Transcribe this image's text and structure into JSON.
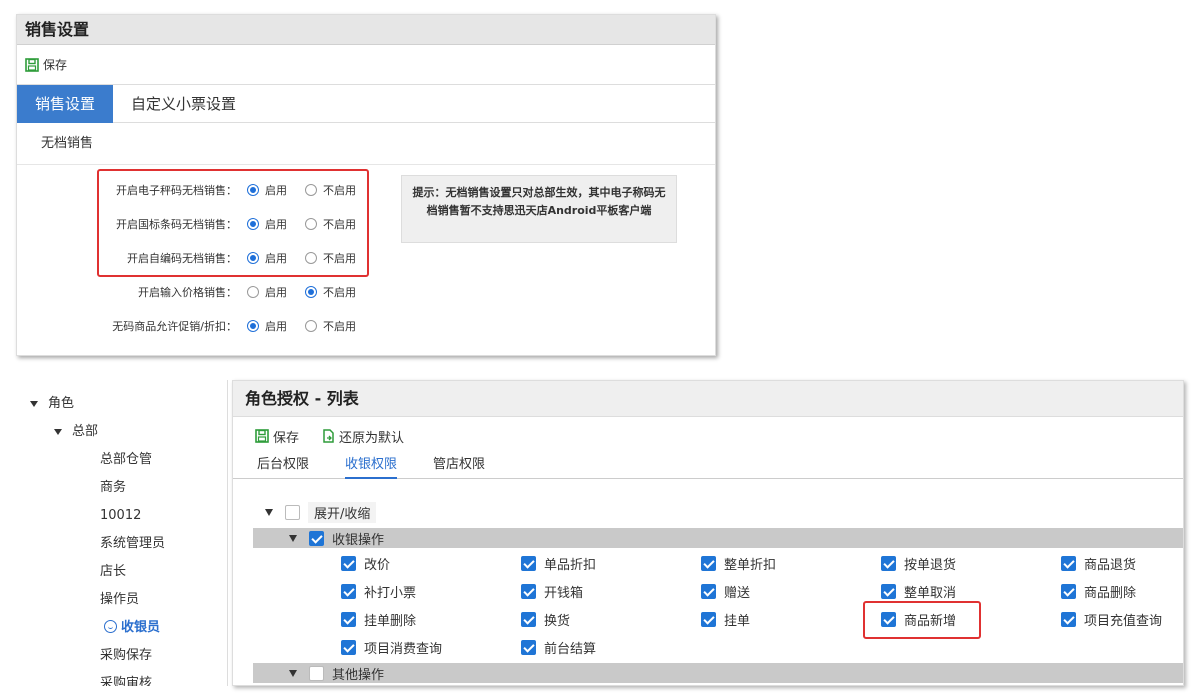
{
  "top": {
    "title": "销售设置",
    "save_label": "保存",
    "tabs": [
      {
        "label": "销售设置",
        "active": true
      },
      {
        "label": "自定义小票设置",
        "active": false
      }
    ],
    "section": "无档销售",
    "options": {
      "on": "启用",
      "off": "不启用"
    },
    "rows": [
      {
        "label": "开启电子秤码无档销售：",
        "value": "on"
      },
      {
        "label": "开启国标条码无档销售：",
        "value": "on"
      },
      {
        "label": "开启自编码无档销售：",
        "value": "on"
      },
      {
        "label": "开启输入价格销售：",
        "value": "off"
      },
      {
        "label": "无码商品允许促销/折扣：",
        "value": "on"
      }
    ],
    "tip": "提示：无档销售设置只对总部生效，其中电子称码无档销售暂不支持思迅天店Android平板客户端"
  },
  "tree": {
    "root": "角色",
    "group": "总部",
    "items": [
      "总部仓管",
      "商务",
      "10012",
      "系统管理员",
      "店长",
      "操作员",
      "收银员",
      "采购保存",
      "采购审核"
    ],
    "selected": "收银员"
  },
  "role": {
    "title": "角色授权 - 列表",
    "save_label": "保存",
    "reset_label": "还原为默认",
    "tabs": [
      {
        "label": "后台权限",
        "active": false
      },
      {
        "label": "收银权限",
        "active": true
      },
      {
        "label": "管店权限",
        "active": false
      }
    ],
    "expand_all": "展开/收缩",
    "groups": [
      {
        "label": "收银操作",
        "checked": true,
        "items": [
          {
            "label": "改价",
            "checked": true
          },
          {
            "label": "单品折扣",
            "checked": true
          },
          {
            "label": "整单折扣",
            "checked": true
          },
          {
            "label": "按单退货",
            "checked": true
          },
          {
            "label": "商品退货",
            "checked": true
          },
          {
            "label": "补打小票",
            "checked": true
          },
          {
            "label": "开钱箱",
            "checked": true
          },
          {
            "label": "赠送",
            "checked": true
          },
          {
            "label": "整单取消",
            "checked": true
          },
          {
            "label": "商品删除",
            "checked": true
          },
          {
            "label": "挂单删除",
            "checked": true
          },
          {
            "label": "换货",
            "checked": true
          },
          {
            "label": "挂单",
            "checked": true
          },
          {
            "label": "商品新增",
            "checked": true
          },
          {
            "label": "项目充值查询",
            "checked": true
          },
          {
            "label": "项目消费查询",
            "checked": true
          },
          {
            "label": "前台结算",
            "checked": true
          }
        ]
      },
      {
        "label": "其他操作",
        "checked": false,
        "items": []
      }
    ]
  },
  "colors": {
    "accent": "#3b7ccd",
    "checkbox": "#1f75d6",
    "highlight_border": "#e03131",
    "save_icon": "#2e9c3a"
  }
}
